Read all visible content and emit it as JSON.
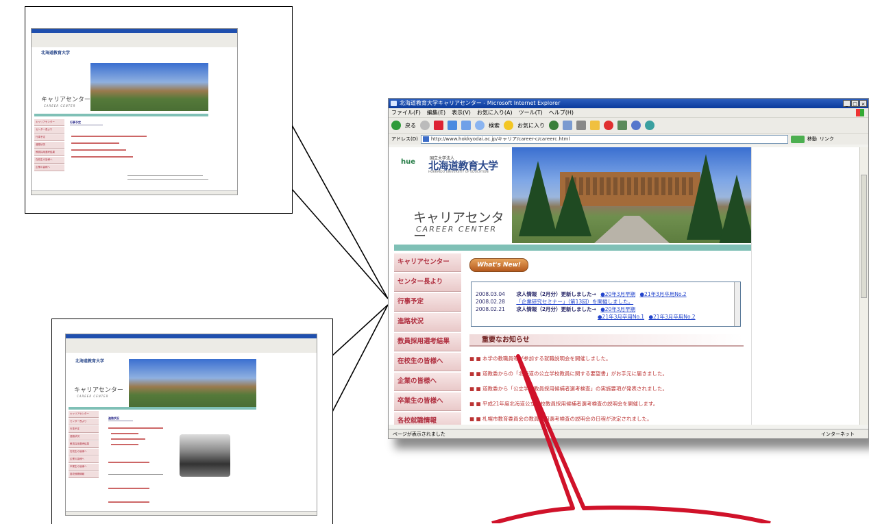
{
  "window": {
    "title": "北海道教育大学キャリアセンター - Microsoft Internet Explorer",
    "menu": [
      "ファイル(F)",
      "編集(E)",
      "表示(V)",
      "お気に入り(A)",
      "ツール(T)",
      "ヘルプ(H)"
    ],
    "toolbar": {
      "back_label": "戻る",
      "search_label": "検索",
      "favorites_label": "お気に入り"
    },
    "address_label": "アドレス(D)",
    "address_value": "http://www.hokkyodai.ac.jp/キャリア/career-c/careerc.html",
    "go_label": "移動",
    "links_label": "リンク",
    "status_text": "ページが表示されました",
    "zone_text": "インターネット"
  },
  "site": {
    "logo_text": "hue",
    "univ_small": "国立大学法人",
    "univ_name": "北海道教育大学",
    "univ_eng": "HOKKAIDO UNIVERSITY OF EDUCATION",
    "title_jp": "キャリアセンター",
    "title_en": "CAREER CENTER"
  },
  "nav": [
    "キャリアセンター",
    "センター長より",
    "行事予定",
    "進路状況",
    "教員採用選考結果",
    "在校生の皆様へ",
    "企業の皆様へ",
    "卒業生の皆様へ",
    "各校就職情報"
  ],
  "whats_new_label": "What's New!",
  "news": [
    {
      "date": "2008.03.04",
      "text": "求人情報（2月分）更新しました→",
      "links": [
        "●20年3月早期",
        "●21年3月卒用No.2"
      ]
    },
    {
      "date": "2008.02.28",
      "text": "「企業研究セミナー」（第13回）を開催しました。",
      "links": []
    },
    {
      "date": "2008.02.21",
      "text": "求人情報（2月分）更新しました→",
      "links": [
        "●20年3月早期"
      ]
    },
    {
      "date": "",
      "text": "",
      "links": [
        "●21年3月卒用No.1",
        "●21年3月卒用No.2"
      ]
    }
  ],
  "notices_title": "重要なお知らせ",
  "notices": [
    "■ 本学の教職員等が参加する就職説明会を開催しました。",
    "■ 道教委からの「北海道の公立学校教員に関する要望書」がお手元に届きました。",
    "■ 道教委から「公立学校教員採用候補者選考検査」の実施要項が発表されました。",
    "■ 平成21年度北海道公立学校教員採用候補者選考検査の説明会を開催します。",
    "■ 札幌市教育委員会の教員採用選考検査の説明会の日程が決定されました。"
  ],
  "thumb_top": {
    "tab_label": "行事予定",
    "univ_name": "北海道教育大学",
    "title_jp": "キャリアセンター",
    "title_en": "CAREER CENTER",
    "nav": [
      "キャリアセンター",
      "センター長より",
      "行事予定",
      "進路状況",
      "教員採用選考結果",
      "在校生の皆様へ",
      "企業の皆様へ"
    ]
  },
  "thumb_bottom": {
    "tab_label": "進路状況",
    "univ_name": "北海道教育大学",
    "title_jp": "キャリアセンター",
    "title_en": "CAREER CENTER",
    "nav": [
      "キャリアセンター",
      "センター長より",
      "行事予定",
      "進路状況",
      "教員採用選考結果",
      "在校生の皆様へ",
      "企業の皆様へ",
      "卒業生の皆様へ",
      "各校就職情報"
    ]
  },
  "colors": {
    "accent_red": "#d0122a",
    "nav_text": "#b03040",
    "band": "#7fc0b6"
  }
}
